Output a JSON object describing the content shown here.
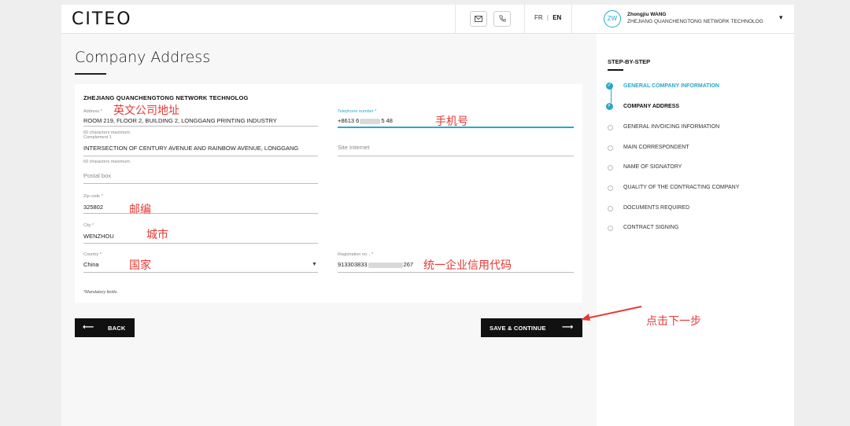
{
  "brand": {
    "logo": "CITEO"
  },
  "header": {
    "mail_icon": "mail-icon",
    "phone_icon": "phone-icon",
    "lang_fr": "FR",
    "lang_sep": "|",
    "lang_en": "EN",
    "avatar_initials": "ZW",
    "user_name": "Zhongjiu WANG",
    "user_company": "ZHEJIANG QUANCHENGTONG NETWORK TECHNOLOG",
    "menu_caret": "▾"
  },
  "page": {
    "title": "Company Address",
    "company_name": "ZHEJIANG QUANCHENGTONG NETWORK TECHNOLOG",
    "mandatory_note": "*Mandatory fields."
  },
  "form": {
    "address": {
      "label": "Address *",
      "value": "ROOM 219, FLOOR 2, BUILDING 2, LONGGANG PRINTING INDUSTRY",
      "hint": "60 characters maximum."
    },
    "complement": {
      "label": "Complement 1",
      "value": "INTERSECTION OF CENTURY AVENUE AND RAINBOW AVENUE, LONGGANG",
      "hint": "60 characters maximum."
    },
    "postal_box": {
      "placeholder": "Postal box"
    },
    "zip": {
      "label": "Zip code *",
      "value": "325802"
    },
    "city": {
      "label": "City *",
      "value": "WENZHOU"
    },
    "country": {
      "label": "Country *",
      "value": "China"
    },
    "telephone": {
      "label": "Telephone number *",
      "value_start": "+8613 6",
      "value_end": "5 48"
    },
    "website": {
      "placeholder": "Site Internet"
    },
    "registration": {
      "label": "Registration no. : *",
      "value_start": "913303833",
      "value_end": "267"
    }
  },
  "annotations": {
    "address": "英文公司地址",
    "phone": "手机号",
    "zip": "邮编",
    "city": "城市",
    "country": "国家",
    "registration": "统一企业信用代码",
    "next_step": "点击下一步"
  },
  "buttons": {
    "back": "BACK",
    "back_arrow": "⟵",
    "save": "SAVE & CONTINUE",
    "save_arrow": "⟶"
  },
  "steps": {
    "title": "STEP-BY-STEP",
    "items": [
      {
        "label": "GENERAL COMPANY INFORMATION",
        "state": "done"
      },
      {
        "label": "COMPANY ADDRESS",
        "state": "current"
      },
      {
        "label": "GENERAL INVOICING INFORMATION",
        "state": "todo"
      },
      {
        "label": "MAIN CORRESPONDENT",
        "state": "todo"
      },
      {
        "label": "NAME OF SIGNATORY",
        "state": "todo"
      },
      {
        "label": "QUALITY OF THE CONTRACTING COMPANY",
        "state": "todo"
      },
      {
        "label": "DOCUMENTS REQUIRED",
        "state": "todo"
      },
      {
        "label": "CONTRACT SIGNING",
        "state": "todo"
      }
    ]
  },
  "colors": {
    "accent": "#27a9c7",
    "annotation": "#e53935",
    "dark_button": "#111111"
  }
}
